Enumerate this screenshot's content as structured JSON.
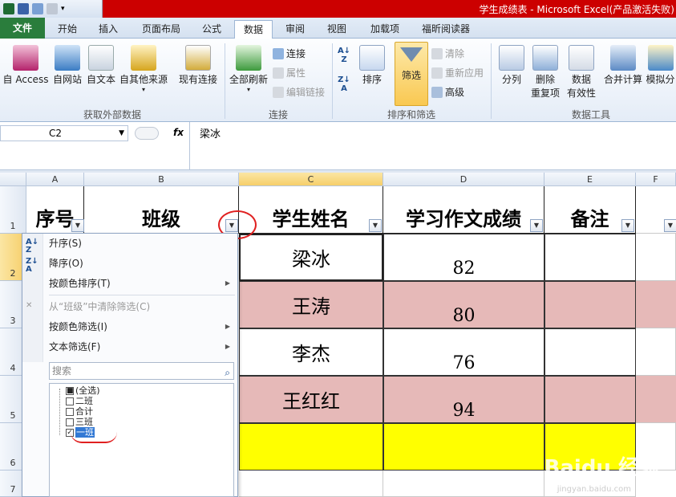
{
  "window": {
    "title": "学生成绩表 - Microsoft Excel(产品激活失败)"
  },
  "ribbon_tabs": [
    "文件",
    "开始",
    "插入",
    "页面布局",
    "公式",
    "数据",
    "审阅",
    "视图",
    "加载项",
    "福昕阅读器"
  ],
  "active_tab": "数据",
  "ribbon": {
    "external": {
      "buttons": [
        "自 Access",
        "自网站",
        "自文本",
        "自其他来源",
        "现有连接"
      ],
      "group": "获取外部数据"
    },
    "connections": {
      "refresh": "全部刷新",
      "connect": "连接",
      "properties": "属性",
      "edit_links": "编辑链接",
      "group": "连接"
    },
    "sortfilter": {
      "sort": "排序",
      "filter": "筛选",
      "clear": "清除",
      "reapply": "重新应用",
      "advanced": "高级",
      "group": "排序和筛选"
    },
    "datatools": {
      "split": "分列",
      "remove_dup_1": "删除",
      "remove_dup_2": "重复项",
      "validation_1": "数据",
      "validation_2": "有效性",
      "consolidate": "合并计算",
      "whatif": "模拟分",
      "group": "数据工具"
    }
  },
  "formula_bar": {
    "name_box": "C2",
    "fx": "fx",
    "content": "梁冰"
  },
  "sheet": {
    "columns": [
      "A",
      "B",
      "C",
      "D",
      "E",
      "F"
    ],
    "rows": [
      "1",
      "2",
      "3",
      "4",
      "5",
      "6",
      "7"
    ],
    "headers": [
      "序号",
      "班级",
      "学生姓名",
      "学习作文成绩",
      "备注"
    ],
    "records": [
      {
        "name": "梁冰",
        "score": "82"
      },
      {
        "name": "王涛",
        "score": "80"
      },
      {
        "name": "李杰",
        "score": "76"
      },
      {
        "name": "王红红",
        "score": "94"
      }
    ]
  },
  "filter_menu": {
    "sort_asc": "升序(S)",
    "sort_desc": "降序(O)",
    "sort_by_color": "按颜色排序(T)",
    "clear_filter": "从“班级”中清除筛选(C)",
    "filter_by_color": "按颜色筛选(I)",
    "text_filter": "文本筛选(F)",
    "search_placeholder": "搜索",
    "items": [
      {
        "label": "(全选)",
        "state": "partial"
      },
      {
        "label": "二班",
        "state": "unchecked"
      },
      {
        "label": "合计",
        "state": "unchecked"
      },
      {
        "label": "三班",
        "state": "unchecked"
      },
      {
        "label": "一班",
        "state": "checked"
      }
    ]
  },
  "watermark": {
    "text": "Baidu 经验",
    "sub": "jingyan.baidu.com"
  },
  "colors": {
    "title_bar": "#cc0000",
    "file_tab": "#2a7d3c",
    "pink_row": "#e6b9b8",
    "yellow_row": "#ffff00",
    "selected_header": "#f6cf6a"
  }
}
